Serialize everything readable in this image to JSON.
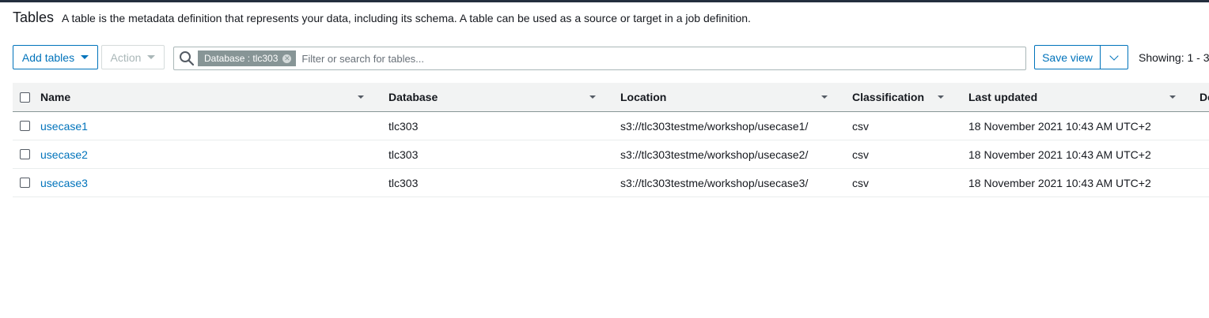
{
  "header": {
    "title": "Tables",
    "description": "A table is the metadata definition that represents your data, including its schema. A table can be used as a source or target in a job definition."
  },
  "toolbar": {
    "add_tables_label": "Add tables",
    "action_label": "Action",
    "filter_token": "Database : tlc303",
    "search_placeholder": "Filter or search for tables...",
    "save_view_label": "Save view",
    "showing_text": "Showing: 1 - 3"
  },
  "table": {
    "columns": [
      "Name",
      "Database",
      "Location",
      "Classification",
      "Last updated",
      "De"
    ],
    "rows": [
      {
        "name": "usecase1",
        "database": "tlc303",
        "location": "s3://tlc303testme/workshop/usecase1/",
        "classification": "csv",
        "last_updated": "18 November 2021 10:43 AM UTC+2"
      },
      {
        "name": "usecase2",
        "database": "tlc303",
        "location": "s3://tlc303testme/workshop/usecase2/",
        "classification": "csv",
        "last_updated": "18 November 2021 10:43 AM UTC+2"
      },
      {
        "name": "usecase3",
        "database": "tlc303",
        "location": "s3://tlc303testme/workshop/usecase3/",
        "classification": "csv",
        "last_updated": "18 November 2021 10:43 AM UTC+2"
      }
    ]
  },
  "colors": {
    "accent": "#0073bb",
    "header_bg": "#f2f3f3",
    "token_bg": "#879596"
  },
  "icons": [
    "search-icon",
    "caret-down-icon",
    "chevron-down-icon",
    "token-remove-icon",
    "sort-icon"
  ]
}
